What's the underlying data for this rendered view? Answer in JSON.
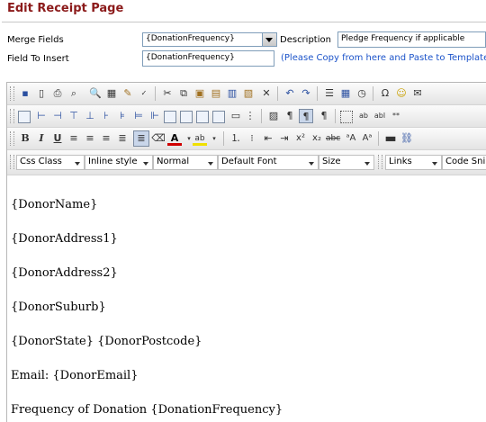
{
  "page": {
    "title": "Edit Receipt Page"
  },
  "form": {
    "merge_fields_label": "Merge Fields",
    "merge_fields_value": "{DonationFrequency}",
    "description_label": "Description",
    "description_value": "Pledge Frequency if applicable",
    "field_to_insert_label": "Field To Insert",
    "field_to_insert_value": "{DonationFrequency}",
    "note": "(Please Copy from here and Paste to Template)"
  },
  "toolbar": {
    "css_class": "Css Class",
    "inline_style": "Inline style",
    "paragraph": "Normal",
    "font": "Default Font",
    "size": "Size",
    "links": "Links",
    "code_snippets": "Code Snip"
  },
  "content": {
    "lines": [
      "{DonorName}",
      "{DonorAddress1}",
      "{DonorAddress2}",
      "{DonorSuburb}",
      "{DonorState}  {DonorPostcode}",
      "Email: {DonorEmail}",
      "Frequency of Donation {DonationFrequency}"
    ]
  }
}
